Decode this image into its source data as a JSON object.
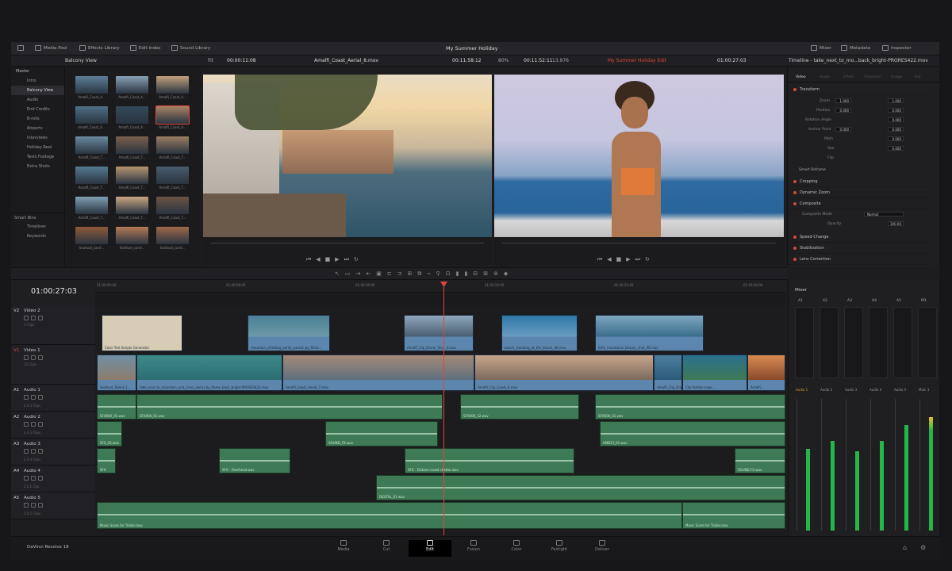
{
  "app": {
    "project_title": "My Summer Holiday",
    "brand": "DaVinci Resolve 18"
  },
  "toolbar": {
    "left": [
      "Media Pool",
      "Effects Library",
      "Edit Index",
      "Sound Library"
    ],
    "right": [
      "Mixer",
      "Metadata",
      "Inspector"
    ]
  },
  "subbar": {
    "bin_name": "Balcony View",
    "src_zoom": "Fit",
    "src_timecode_in": "00:00:11:08",
    "src_clip": "Amalfi_Coast_Aerial_8.mov",
    "src_timecode": "00:11:58:12",
    "zoom": "80%",
    "timecode_out": "00:11:52:11",
    "rate": "13.976",
    "timeline_name": "My Summer Holiday Edit",
    "program_timecode": "01:00:27:03",
    "inspector_title": "Timeline - take_next_to_mo...back_bright-PRORES422.mov"
  },
  "bins": {
    "master": "Master",
    "items": [
      "Intro",
      "Balcony View",
      "Audio",
      "End Credits",
      "B-rolls",
      "Airports",
      "Interviews",
      "Holiday Reel",
      "Tests Footage",
      "Extra Shots"
    ],
    "smart_bins": "Smart Bins",
    "smart_items": [
      "Timelines",
      "Keywords"
    ]
  },
  "media_thumbs": [
    "Amalfi_Coast_A...",
    "Amalfi_Coast_A...",
    "Amalfi_Coast_A...",
    "Amalfi_Coast_A...",
    "Amalfi_Coast_A...",
    "Amalfi_Coast_A...",
    "Amalfi_Coast_T...",
    "Amalfi_Coast_T...",
    "Amalfi_Coast_T...",
    "Amalfi_Coast_T...",
    "Amalfi_Coast_T...",
    "Amalfi_Coast_T...",
    "Amalfi_Coast_T...",
    "Amalfi_Coast_T...",
    "Amalfi_Coast_T...",
    "Seafood_sand...",
    "Seafood_sand...",
    "Seafood_sand..."
  ],
  "inspector": {
    "tabs": [
      "Video",
      "Audio",
      "Effect",
      "Transition",
      "Image",
      "File"
    ],
    "transform": "Transform",
    "zoom_label": "Zoom",
    "zoom_x": "1.000",
    "zoom_y": "1.000",
    "position_label": "Position",
    "pos_x": "0.000",
    "pos_y": "0.000",
    "rotation_label": "Rotation Angle",
    "rotation": "0.000",
    "anchor_label": "Anchor Point",
    "anchor_x": "0.000",
    "anchor_y": "0.000",
    "pitch_label": "Pitch",
    "pitch": "0.000",
    "yaw_label": "Yaw",
    "yaw": "0.000",
    "flip_label": "Flip",
    "smart_reframe": "Smart Reframe",
    "sections": [
      "Cropping",
      "Dynamic Zoom",
      "Composite",
      "Speed Change",
      "Stabilization",
      "Lens Correction"
    ],
    "composite_mode_label": "Composite Mode",
    "composite_mode": "Normal",
    "opacity_label": "Opacity",
    "opacity": "100.00"
  },
  "timeline": {
    "timecode": "01:00:27:03",
    "ruler": [
      "01:00:00:00",
      "01:00:08:00",
      "01:00:16:00",
      "01:00:24:00",
      "01:00:32:00",
      "01:00:40:00",
      "01:00:48:00"
    ],
    "tracks": [
      {
        "id": "V2",
        "name": "Video 2",
        "sub": "3 Clips"
      },
      {
        "id": "V1",
        "name": "Video 1",
        "sub": "23 Clips"
      },
      {
        "id": "A1",
        "name": "Audio 1",
        "sub": "2.0  3 Clips"
      },
      {
        "id": "A2",
        "name": "Audio 2",
        "sub": "2.0  3 Clips"
      },
      {
        "id": "A3",
        "name": "Audio 3",
        "sub": "2.0  4 Clips"
      },
      {
        "id": "A4",
        "name": "Audio 4",
        "sub": "2.0  1 Clip"
      },
      {
        "id": "A5",
        "name": "Audio 5",
        "sub": "2.0  2 Clips"
      }
    ],
    "v2_clips": [
      "Color Test Simple Generator",
      "mountain_climbing_aerial_sunset_by_filmic...",
      "Amalfi_Clip_Drone_Shot_4.mov",
      "beach_standing_at_the_beach_4K.mov",
      "little_mountains_beauty_shot_4K.mov"
    ],
    "v1_clips": [
      "Seafood_Talent_1...",
      "take_next_to_mountain_and_cross_aerial_by_flame_back_bright-PRORES422.mov",
      "Amalfi_Coast_Aerial_7.mov",
      "Amalfi_City_Coast_6.mov",
      "Amalfi_Clip_Drone_...",
      "Clip Rotate large...",
      "Amalfi..."
    ],
    "a1_clips": [
      "SFX000_01.wav",
      "SFX000_01.wav",
      "SFX000_12.wav",
      "SFX000_01.wav"
    ],
    "a2_clips": [
      "SFX_03.wav",
      "SOUND_FX.wav",
      "AMB13_01.wav"
    ],
    "a3_clips": [
      "SFX",
      "SFX - Overhead.wav",
      "SFX - Distant crowd chatter.wav",
      "SOUND FX.wav"
    ],
    "a4_clips": [
      "DIGITAL_01.wav"
    ],
    "a5_clips": [
      "Music Score for Trailer.mov",
      "Music Score for Trailer.mov"
    ]
  },
  "mixer": {
    "title": "Mixer",
    "channels": [
      "A1",
      "A2",
      "A3",
      "A4",
      "A5",
      "M1"
    ],
    "strips": [
      "Audio 1",
      "Audio 2",
      "Audio 3",
      "Audio 4",
      "Audio 5",
      "Main 1"
    ],
    "levels": [
      0.62,
      0.68,
      0.6,
      0.68,
      0.8,
      0.86
    ],
    "meter_color": "#25b64a"
  },
  "pages": {
    "tabs": [
      "Media",
      "Cut",
      "Edit",
      "Fusion",
      "Color",
      "Fairlight",
      "Deliver"
    ],
    "active": "Edit"
  },
  "colors": {
    "playhead": "#e0453a",
    "video_clip": "#5c86ae",
    "audio_clip": "#3e7a55",
    "active_tab": "#000000"
  }
}
